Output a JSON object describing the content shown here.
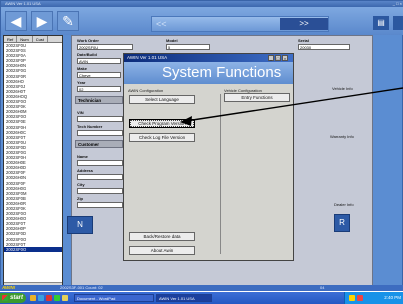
{
  "main_window": {
    "title": "AWIN Ver 1.01 USA",
    "title_controls": "_ □ ×"
  },
  "toolbar": {
    "back_icon": "left-arrow-icon",
    "forward_icon": "right-arrow-icon",
    "prev_label": "<<",
    "next_label": ">>"
  },
  "left_list": {
    "tabs": [
      "Ref",
      "Num",
      "Cust"
    ],
    "items": [
      "2002SF0U",
      "2002SF0S",
      "2002SF0A",
      "2002SF0P",
      "20026H0N",
      "2002SF0G",
      "2002SF0R",
      "20026HO",
      "2002SF0J",
      "20026H0T",
      "20026HOQ",
      "2002SF0O",
      "2002SF0K",
      "20026H0M",
      "2002SF0O",
      "2002SF0E",
      "2002SF0H",
      "20026H0C",
      "2002SF0T",
      "2002SF0U",
      "2002SF0D",
      "2002SF0G",
      "2002SF0H",
      "20026H0E",
      "20026H0D",
      "2002SF0F",
      "20026H0N",
      "2002SF0F",
      "20026H0G",
      "2002SF0M",
      "2002SF0B",
      "20026H0R",
      "2002SF0K",
      "2002SF0O",
      "20026H0O",
      "2002SF0T",
      "20026H0P",
      "2002SF0D",
      "2002SF0O",
      "2002SF0T",
      "2002SF0O"
    ],
    "selected_index": 40
  },
  "form": {
    "labels": {
      "work_order": "Work Order",
      "model": "Model",
      "serial": "Serial",
      "date": "Date/Build",
      "make": "Make",
      "year": "Year",
      "technician": "Technician",
      "vin": "VIN",
      "tech_num": "Tech Number",
      "customer": "Customer",
      "name": "Name",
      "address": "Address",
      "city": "City",
      "zip": "Zip"
    },
    "values": {
      "work_order": "2002SF0U",
      "model": "5",
      "serial": "20030",
      "date": "AVIN",
      "make": "Cheve",
      "year": "02"
    },
    "section_technician": "Technician",
    "section_customer": "Customer",
    "side_label_1": "Vehicle Info",
    "side_label_2": "Warranty Info",
    "side_label_3": "Dealer Info",
    "doc_button_label": "N",
    "doc_button_label_2": "R"
  },
  "dialog": {
    "title": "AWIN Ver 1.01 USA",
    "heading": "System Functions",
    "left_column_label": "AWIN Configuration",
    "right_column_label": "Vehicle Configuration",
    "buttons": {
      "select_language": "Select Language",
      "entry_functions": "Entry Functions",
      "check_program_version": "Check Program Version",
      "check_log_file_version": "Check Log File Version",
      "backup_restore": "Back/Restore data",
      "about_awin": "About Awin"
    }
  },
  "status_bar": {
    "logo": "AWIN!",
    "text": "2002S3F-001   Count: 02",
    "right": "04"
  },
  "taskbar": {
    "start_label": "start",
    "tasks": [
      "Document - WordPad",
      "AWIN Ver 1.01 USA"
    ],
    "clock": "2:40 PM"
  },
  "colors": {
    "title_gradient_start": "#0b2b7a",
    "header_blue": "#5f8dd0",
    "selected_row": "#0a2f8c"
  }
}
